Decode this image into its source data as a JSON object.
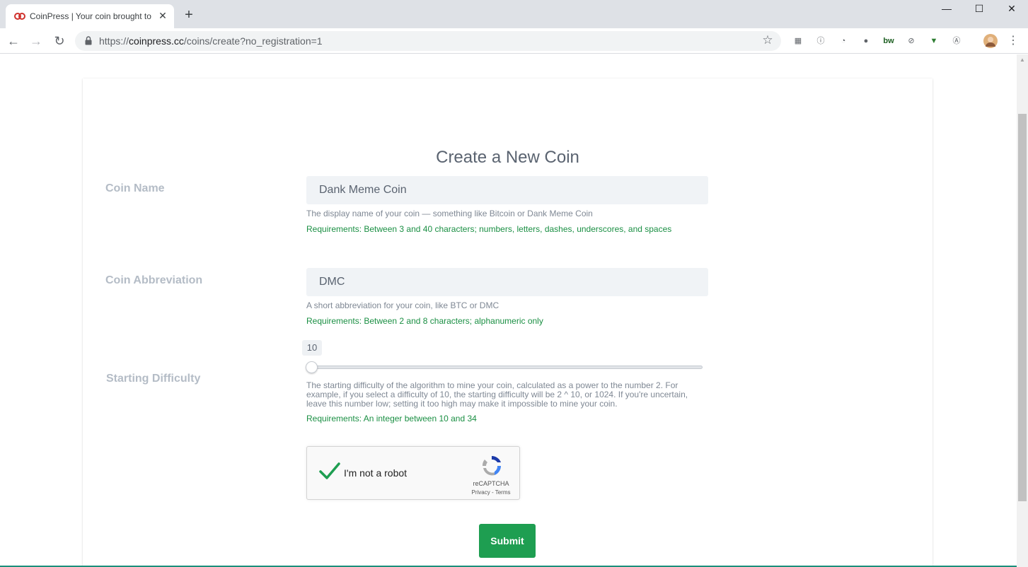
{
  "browser": {
    "tab_title": "CoinPress | Your coin brought to",
    "tab_close": "✕",
    "new_tab": "+",
    "url_scheme": "https://",
    "url_host": "coinpress.cc",
    "url_path": "/coins/create?no_registration=1",
    "window_controls": {
      "minimize": "—",
      "maximize": "☐",
      "close": "✕"
    },
    "extensions": [
      "ext-grid-icon",
      "1password-icon",
      "clock-ext-icon",
      "ghost-ext-icon",
      "bw-ext-icon",
      "block-ext-icon",
      "vue-devtools-icon",
      "a-ext-icon",
      "profile-avatar"
    ],
    "ext_bw_label": "bw"
  },
  "page": {
    "title": "Create a New Coin",
    "coin_name": {
      "label": "Coin Name",
      "value": "Dank Meme Coin",
      "help": "The display name of your coin — something like Bitcoin or Dank Meme Coin",
      "requirements": "Requirements: Between 3 and 40 characters; numbers, letters, dashes, underscores, and spaces"
    },
    "coin_abbreviation": {
      "label": "Coin Abbreviation",
      "value": "DMC",
      "help": "A short abbreviation for your coin, like BTC or DMC",
      "requirements": "Requirements: Between 2 and 8 characters; alphanumeric only"
    },
    "starting_difficulty": {
      "label": "Starting Difficulty",
      "value": "10",
      "min": 10,
      "max": 34,
      "help": "The starting difficulty of the algorithm to mine your coin, calculated as a power to the number 2. For example, if you select a difficulty of 10, the starting difficulty will be 2 ^ 10, or 1024. If you're uncertain, leave this number low; setting it too high may make it impossible to mine your coin.",
      "requirements": "Requirements: An integer between 10 and 34"
    },
    "captcha": {
      "label": "I'm not a robot",
      "brand": "reCAPTCHA",
      "links": "Privacy - Terms",
      "checked": true
    },
    "submit_label": "Submit"
  },
  "colors": {
    "accent_green": "#1e9e51",
    "requirement_green": "#1a8f43",
    "label_gray": "#b4bcc6"
  }
}
